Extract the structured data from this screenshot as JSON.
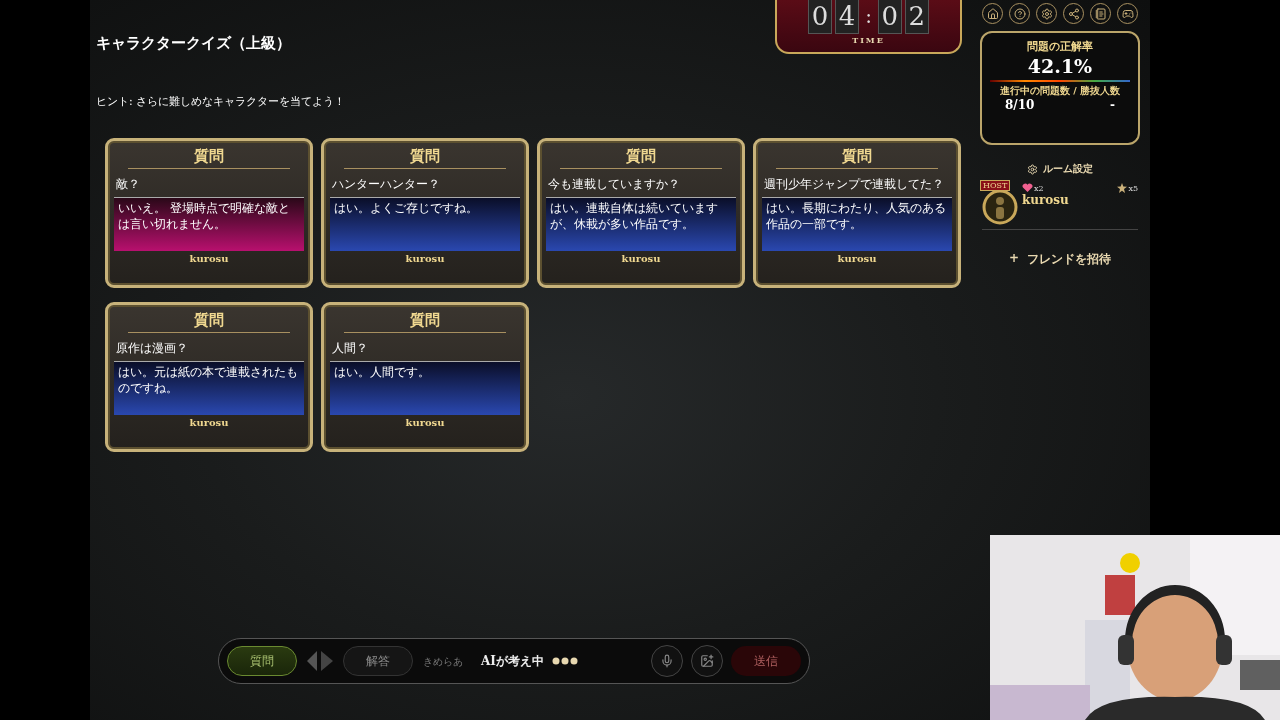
{
  "title": "キャラクタークイズ（上級）",
  "hint": "ヒント: さらに難しめなキャラクターを当てよう！",
  "timer": {
    "digits": [
      "0",
      "4",
      "0",
      "2"
    ],
    "separator": ":",
    "label": "TIME"
  },
  "stats": {
    "title": "問題の正解率",
    "rate": "42.1%",
    "subtitle": "進行中の問題数 / 勝抜人数",
    "progress": "8/10",
    "winners": "-"
  },
  "room_settings": "ルーム設定",
  "player": {
    "badge": "HOST",
    "hearts": "x2",
    "star_count": "x5",
    "name": "kurosu"
  },
  "invite": {
    "icon": "+",
    "label": "フレンドを招待"
  },
  "cards": [
    {
      "heading": "質問",
      "question": "敵？",
      "answer": "いいえ。 登場時点で明確な敵とは言い切れません。",
      "correct": false,
      "author": "kurosu"
    },
    {
      "heading": "質問",
      "question": "ハンターハンター？",
      "answer": "はい。よくご存じですね。",
      "correct": true,
      "author": "kurosu"
    },
    {
      "heading": "質問",
      "question": "今も連載していますか？",
      "answer": "はい。連載自体は続いていますが、休載が多い作品です。",
      "correct": true,
      "author": "kurosu"
    },
    {
      "heading": "質問",
      "question": "週刊少年ジャンプで連載してた？",
      "answer": "はい。長期にわたり、人気のある作品の一部です。",
      "correct": true,
      "author": "kurosu"
    },
    {
      "heading": "質問",
      "question": "原作は漫画？",
      "answer": "はい。元は紙の本で連載されたものですね。",
      "correct": true,
      "author": "kurosu"
    },
    {
      "heading": "質問",
      "question": "人間？",
      "answer": "はい。人間です。",
      "correct": true,
      "author": "kurosu"
    }
  ],
  "input_bar": {
    "modes": [
      {
        "label": "質問",
        "selected": true
      },
      {
        "label": "解答",
        "selected": false
      }
    ],
    "placeholder": "きめらあ",
    "status": "AIが考え中",
    "send": "送信",
    "send_disabled": true
  }
}
